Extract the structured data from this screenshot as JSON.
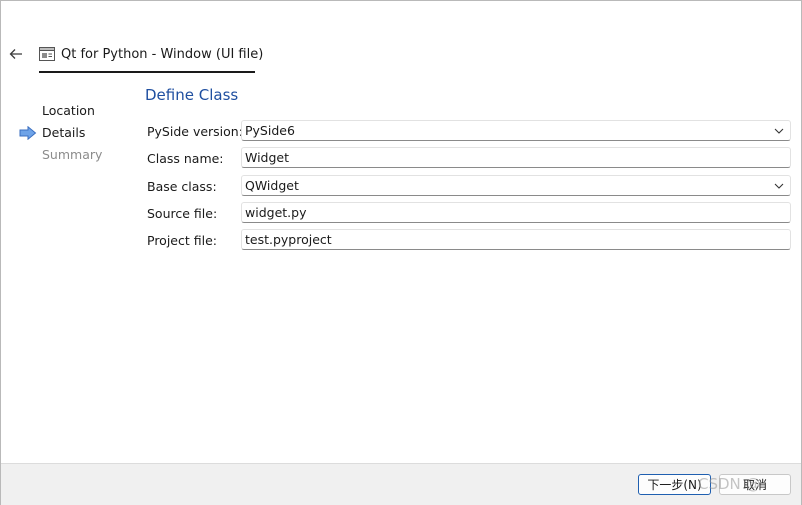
{
  "header": {
    "title": "Qt for Python - Window (UI file)"
  },
  "steps": [
    {
      "label": "Location",
      "state": "done"
    },
    {
      "label": "Details",
      "state": "current"
    },
    {
      "label": "Summary",
      "state": "pending"
    }
  ],
  "form": {
    "section_title": "Define Class",
    "pyside_version": {
      "label": "PySide version:",
      "value": "PySide6"
    },
    "class_name": {
      "label": "Class name:",
      "value": "Widget"
    },
    "base_class": {
      "label": "Base class:",
      "value": "QWidget"
    },
    "source_file": {
      "label": "Source file:",
      "value": "widget.py"
    },
    "project_file": {
      "label": "Project file:",
      "value": "test.pyproject"
    }
  },
  "footer": {
    "next_label": "下一步(N)",
    "cancel_label": "取消"
  },
  "watermark": "CSDN @",
  "colors": {
    "section_title": "#1f4fa0",
    "step_arrow": "#4a86d4",
    "footer_bg": "#f0f0f0"
  },
  "icons": {
    "back": "arrow-left-icon",
    "window": "qt-window-icon",
    "current_step": "arrow-right-icon",
    "dropdown": "chevron-down-icon"
  }
}
